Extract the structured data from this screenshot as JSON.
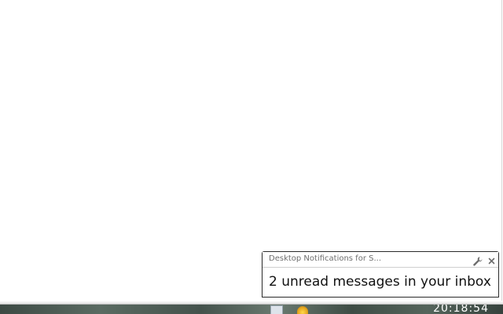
{
  "notification": {
    "title": "Desktop Notifications for S...",
    "message": "2 unread messages in your inbox",
    "settings_icon": "wrench-icon",
    "close_icon": "close-icon"
  },
  "taskbar": {
    "clock": "20:18:54"
  },
  "colors": {
    "notification_border": "#2a2a2a",
    "notification_title": "#6f6f6f",
    "taskbar": "#4a5a52"
  }
}
